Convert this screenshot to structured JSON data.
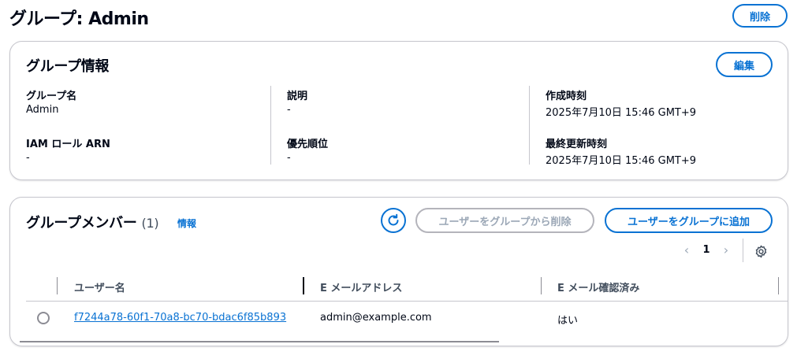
{
  "page": {
    "title": "グループ: Admin",
    "delete_label": "削除"
  },
  "group_info": {
    "title": "グループ情報",
    "edit_label": "編集",
    "fields": {
      "group_name": {
        "label": "グループ名",
        "value": "Admin"
      },
      "description": {
        "label": "説明",
        "value": "-"
      },
      "created": {
        "label": "作成時刻",
        "value": "2025年7月10日 15:46 GMT+9"
      },
      "iam_role": {
        "label": "IAM ロール ARN",
        "value": "-"
      },
      "precedence": {
        "label": "優先順位",
        "value": "-"
      },
      "updated": {
        "label": "最終更新時刻",
        "value": "2025年7月10日 15:46 GMT+9"
      }
    }
  },
  "members": {
    "title": "グループメンバー",
    "count": "(1)",
    "info_label": "情報",
    "remove_label": "ユーザーをグループから削除",
    "add_label": "ユーザーをグループに追加",
    "pagination": {
      "current_page": "1"
    },
    "columns": [
      "ユーザー名",
      "E メールアドレス",
      "E メール確認済み"
    ],
    "rows": [
      {
        "username": "f7244a78-60f1-70a8-bc70-bdac6f85b893",
        "email": "admin@example.com",
        "verified": "はい"
      }
    ],
    "icons": {
      "refresh": "refresh-icon",
      "settings": "gear-icon",
      "prev": "chevron-left-icon",
      "next": "chevron-right-icon"
    },
    "accent_color": "#0972d3"
  }
}
